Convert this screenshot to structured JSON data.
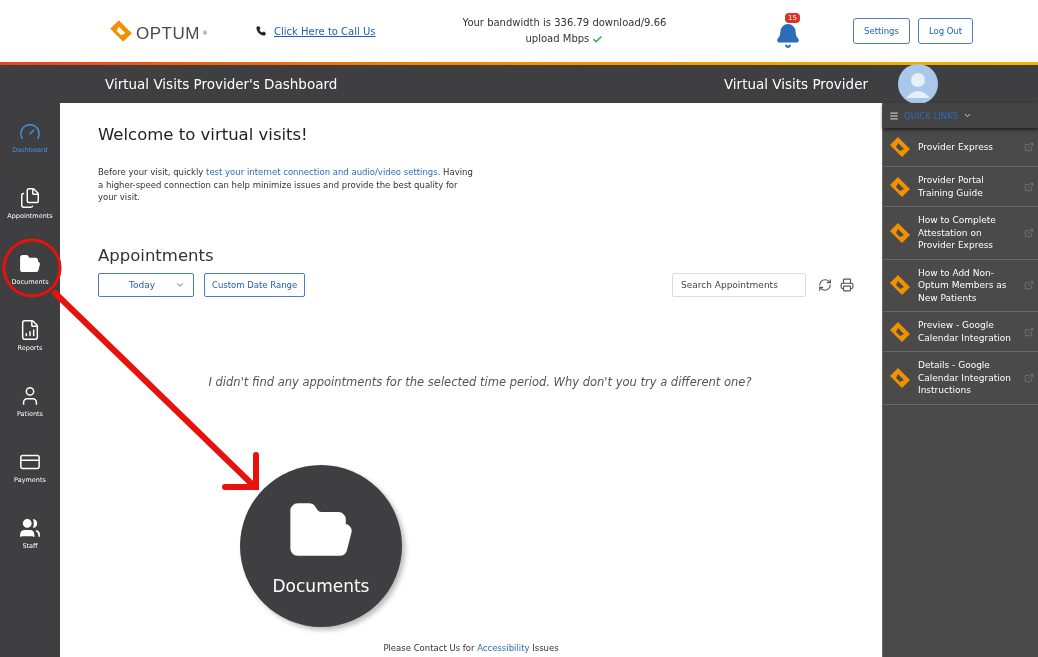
{
  "header": {
    "logo": "OPTUM",
    "logo_mark": "®",
    "call_link": "Click Here to Call Us",
    "bandwidth": "Your bandwidth is 336.79 download/9.66 upload Mbps",
    "notifications": "15",
    "buttons": [
      "Settings",
      "Log Out"
    ]
  },
  "title_bar": {
    "title": "Virtual Visits Provider's Dashboard",
    "user": "Virtual Visits Provider"
  },
  "sidebar": {
    "items": [
      {
        "label": "Dashboard",
        "kind": "gauge",
        "selected": true
      },
      {
        "label": "Appointments",
        "kind": "files",
        "selected": false
      },
      {
        "label": "Documents",
        "kind": "folder",
        "selected": false
      },
      {
        "label": "Reports",
        "kind": "reports",
        "selected": false
      },
      {
        "label": "Patients",
        "kind": "user",
        "selected": false
      },
      {
        "label": "Payments",
        "kind": "card",
        "selected": false
      },
      {
        "label": "Staff",
        "kind": "users",
        "selected": false
      }
    ]
  },
  "welcome": {
    "title": "Welcome to virtual visits!",
    "before": "Before your visit, quickly ",
    "link": "test your internet connection and audio/video settings",
    "after": ". Having a higher-speed connection can help minimize issues and provide the best quality for your visit."
  },
  "appointments": {
    "title": "Appointments",
    "range": "Today",
    "custom_button": "Custom Date Range",
    "search_placeholder": "Search Appointments",
    "empty_message": "I didn't find any appointments for the selected time period. Why don't you try a different one?"
  },
  "quick_links": {
    "title": "QUICK LINKS",
    "items": [
      "Provider Express",
      "Provider Portal Training Guide",
      "How to Complete Attestation on Provider Express",
      "How to Add Non-Optum Members as New Patients",
      "Preview - Google Calendar Integration",
      "Details - Google Calendar Integration Instructions"
    ]
  },
  "footer": {
    "before": "Please Contact Us for ",
    "link": "Accessibility",
    "after": " Issues"
  },
  "annotation": {
    "callout_label": "Documents"
  }
}
